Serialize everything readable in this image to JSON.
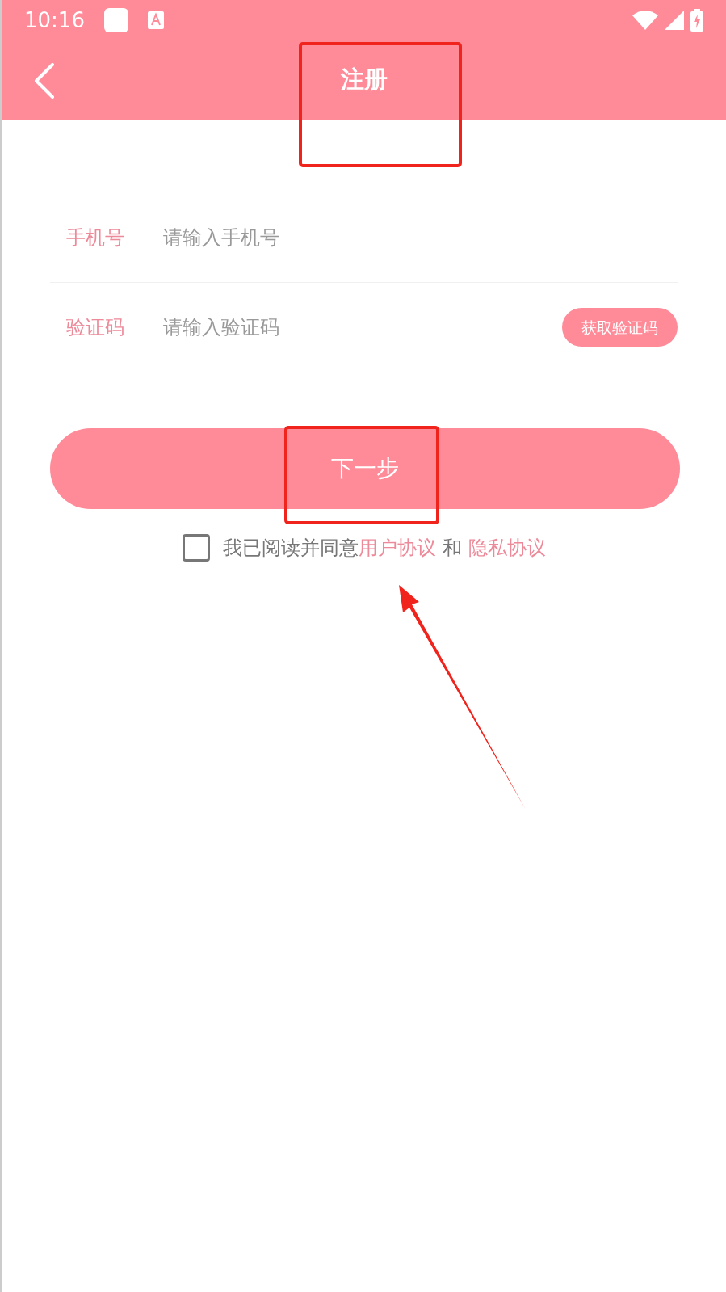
{
  "status_bar": {
    "time": "10:16"
  },
  "header": {
    "title": "注册"
  },
  "form": {
    "fields": [
      {
        "label": "手机号",
        "placeholder": "请输入手机号"
      },
      {
        "label": "验证码",
        "placeholder": "请输入验证码",
        "action": "获取验证码"
      }
    ],
    "submit": "下一步"
  },
  "agreement": {
    "checked": false,
    "parts": [
      {
        "kind": "text",
        "text": "我已阅读并同意"
      },
      {
        "kind": "link",
        "text": "用户协议"
      },
      {
        "kind": "text",
        "text": "和"
      },
      {
        "kind": "link",
        "text": "隐私协议"
      }
    ]
  }
}
